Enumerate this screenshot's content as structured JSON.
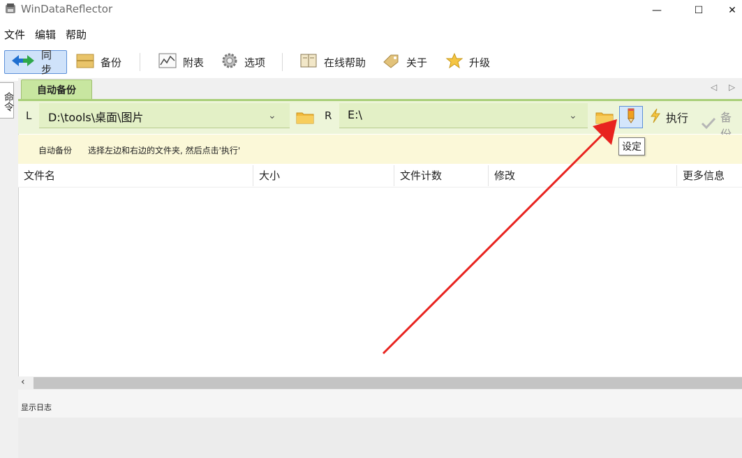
{
  "window": {
    "title": "WinDataReflector",
    "minimize_glyph": "—",
    "maximize_glyph": "☐",
    "close_glyph": "✕"
  },
  "menu": [
    "文件",
    "编辑",
    "帮助"
  ],
  "toolbar": {
    "sync": "同步",
    "backup": "备份",
    "schedule": "附表",
    "options": "选项",
    "online_help": "在线帮助",
    "about": "关于",
    "upgrade": "升级"
  },
  "left_tab_label": "命令",
  "tab": {
    "label": "自动备份",
    "prev": "◁",
    "next": "▷"
  },
  "paths": {
    "left_letter": "L",
    "left_value": "D:\\tools\\桌面\\图片",
    "right_letter": "R",
    "right_value": "E:\\",
    "dropdown_glyph": "⌄"
  },
  "actions": {
    "execute": "执行",
    "backup": "备份",
    "settings_tooltip": "设定"
  },
  "info": {
    "title": "自动备份",
    "text": "选择左边和右边的文件夹, 然后点击'执行'"
  },
  "table": {
    "columns": [
      "文件名",
      "大小",
      "文件计数",
      "修改",
      "更多信息"
    ]
  },
  "scroll": {
    "left_arrow": "‹"
  },
  "log": {
    "title": "显示日志"
  },
  "colors": {
    "tab_green": "#c8e6a0",
    "path_green": "#edf5d9",
    "info_yellow": "#fbf8d8",
    "accent_blue": "#5b8fd8",
    "arrow_red": "#e8231f"
  }
}
